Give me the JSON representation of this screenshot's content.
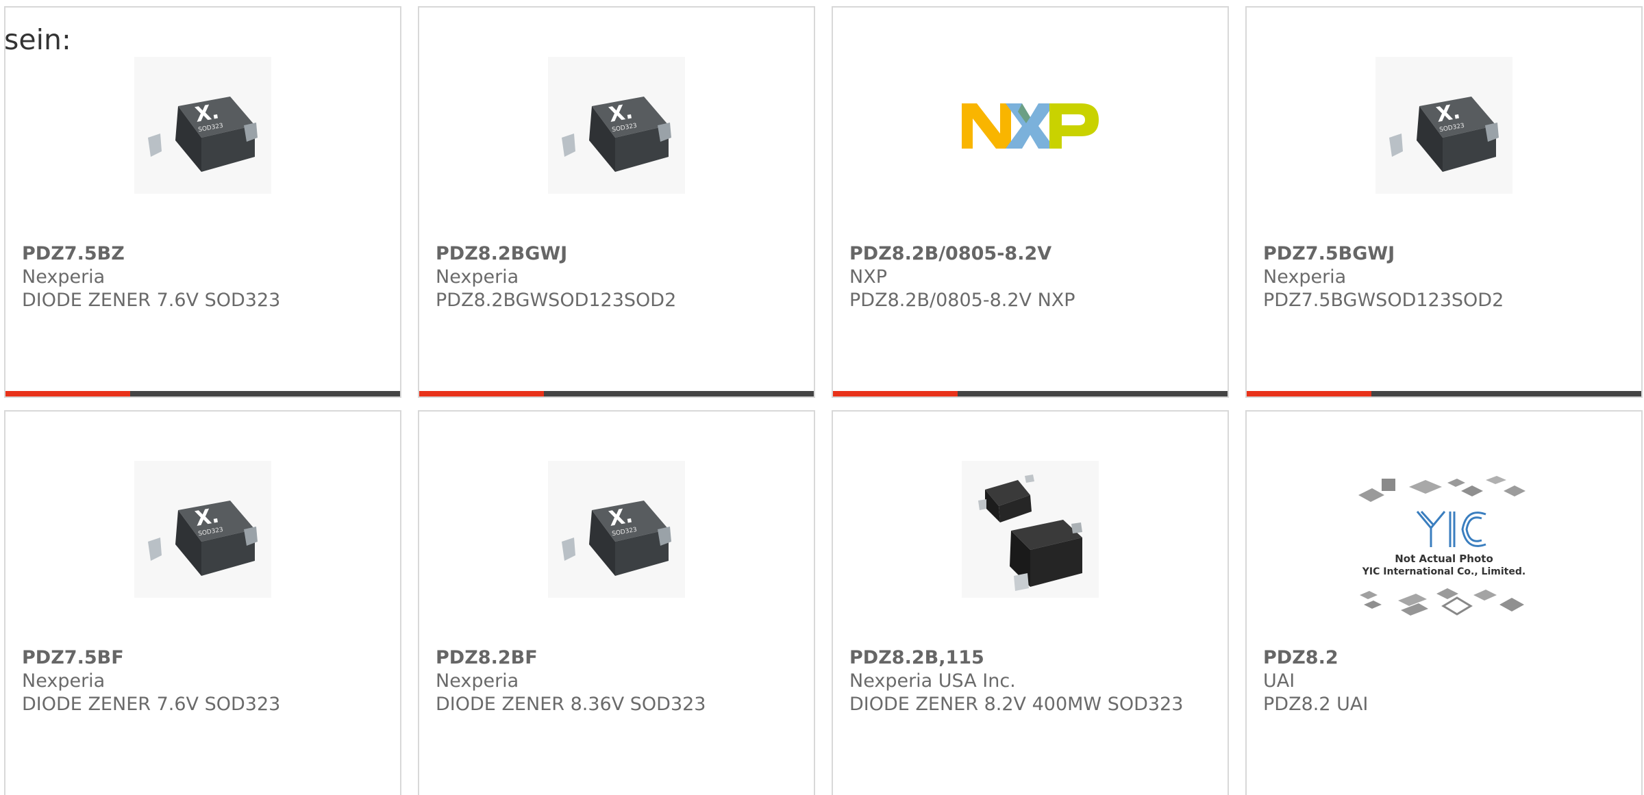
{
  "intro_text": "sein:",
  "products": [
    {
      "part": "PDZ7.5BZ",
      "manufacturer": "Nexperia",
      "description": "DIODE ZENER 7.6V SOD323",
      "image": "sod323-nexperia-package",
      "package_label": "SOD323"
    },
    {
      "part": "PDZ8.2BGWJ",
      "manufacturer": "Nexperia",
      "description": "PDZ8.2BGWSOD123SOD2",
      "image": "sod323-nexperia-package",
      "package_label": "SOD323"
    },
    {
      "part": "PDZ8.2B/0805-8.2V",
      "manufacturer": "NXP",
      "description": "PDZ8.2B/0805-8.2V NXP",
      "image": "nxp-logo"
    },
    {
      "part": "PDZ7.5BGWJ",
      "manufacturer": "Nexperia",
      "description": "PDZ7.5BGWSOD123SOD2",
      "image": "sod323-nexperia-package",
      "package_label": "SOD323"
    },
    {
      "part": "PDZ7.5BF",
      "manufacturer": "Nexperia",
      "description": "DIODE ZENER 7.6V SOD323",
      "image": "sod323-nexperia-package",
      "package_label": "SOD323"
    },
    {
      "part": "PDZ8.2BF",
      "manufacturer": "Nexperia",
      "description": "DIODE ZENER 8.36V SOD323",
      "image": "sod323-nexperia-package",
      "package_label": "SOD323"
    },
    {
      "part": "PDZ8.2B,115",
      "manufacturer": "Nexperia USA Inc.",
      "description": "DIODE ZENER 8.2V 400MW SOD323",
      "image": "sod323-black-diodes"
    },
    {
      "part": "PDZ8.2",
      "manufacturer": "UAI",
      "description": "PDZ8.2 UAI",
      "image": "yic-placeholder",
      "placeholder_caption": "Not Actual Photo",
      "placeholder_company": "YIC International Co., Limited."
    }
  ],
  "colors": {
    "card_border": "#d8d8d8",
    "accent_bar": "#e8321a",
    "dark_bar": "#444444",
    "text_muted": "#6a6a6a",
    "nxp_orange": "#f9b500",
    "nxp_blue": "#7bb1db",
    "nxp_green": "#c9d200"
  }
}
